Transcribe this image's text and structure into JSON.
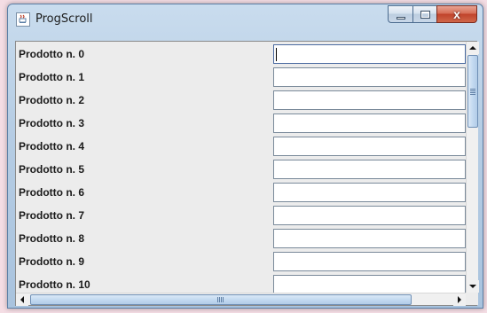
{
  "window": {
    "title": "ProgScroll",
    "icon": "java-coffee-icon"
  },
  "caption_buttons": {
    "minimize_icon": "minimize-icon",
    "maximize_icon": "maximize-icon",
    "close_glyph": "x"
  },
  "list": {
    "rows": [
      {
        "label": "Prodotto n. 0",
        "value": ""
      },
      {
        "label": "Prodotto n. 1",
        "value": ""
      },
      {
        "label": "Prodotto n. 2",
        "value": ""
      },
      {
        "label": "Prodotto n. 3",
        "value": ""
      },
      {
        "label": "Prodotto n. 4",
        "value": ""
      },
      {
        "label": "Prodotto n. 5",
        "value": ""
      },
      {
        "label": "Prodotto n. 6",
        "value": ""
      },
      {
        "label": "Prodotto n. 7",
        "value": ""
      },
      {
        "label": "Prodotto n. 8",
        "value": ""
      },
      {
        "label": "Prodotto n. 9",
        "value": ""
      },
      {
        "label": "Prodotto n. 10",
        "value": ""
      }
    ]
  },
  "colors": {
    "title_bar": "#b6cde4",
    "close_button": "#c0432b",
    "scroll_thumb": "#c3d9f0"
  }
}
